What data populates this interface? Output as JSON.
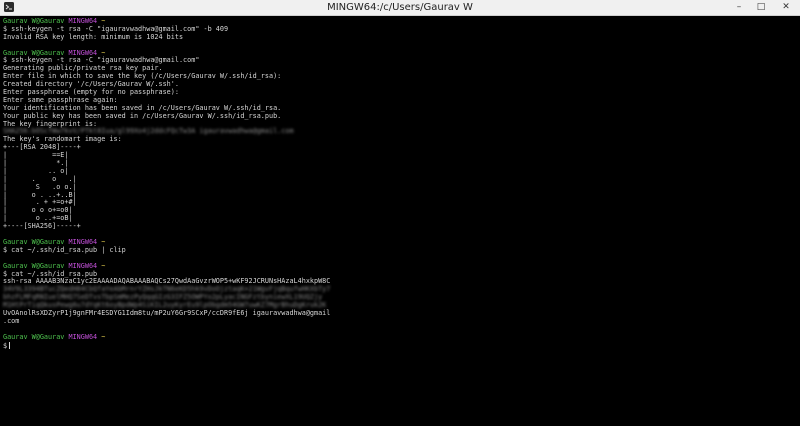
{
  "window": {
    "title": "MINGW64:/c/Users/Gaurav W",
    "minimize_glyph": "–",
    "maximize_glyph": "□",
    "close_glyph": "✕"
  },
  "colors": {
    "user": "#4ec24e",
    "host": "#c04fd6",
    "path": "#d8c24a",
    "text": "#d6d6d6",
    "background": "#000000"
  },
  "prompt": {
    "user": "Gaurav W@Gaurav",
    "host": "MINGW64",
    "path": "~",
    "symbol": "$"
  },
  "session": [
    {
      "type": "prompt"
    },
    {
      "type": "cmd",
      "text": "$ ssh-keygen -t rsa -C \"igauravwadhwa@gmail.com\" -b 409"
    },
    {
      "type": "out",
      "text": "Invalid RSA key length: minimum is 1024 bits"
    },
    {
      "type": "blank"
    },
    {
      "type": "prompt"
    },
    {
      "type": "cmd",
      "text": "$ ssh-keygen -t rsa -C \"igauravwadhwa@gmail.com\""
    },
    {
      "type": "out",
      "text": "Generating public/private rsa key pair."
    },
    {
      "type": "out",
      "text": "Enter file in which to save the key (/c/Users/Gaurav W/.ssh/id_rsa):"
    },
    {
      "type": "out",
      "text": "Created directory '/c/Users/Gaurav W/.ssh'."
    },
    {
      "type": "out",
      "text": "Enter passphrase (empty for no passphrase):"
    },
    {
      "type": "out",
      "text": "Enter same passphrase again:"
    },
    {
      "type": "out",
      "text": "Your identification has been saved in /c/Users/Gaurav W/.ssh/id_rsa."
    },
    {
      "type": "out",
      "text": "Your public key has been saved in /c/Users/Gaurav W/.ssh/id_rsa.pub."
    },
    {
      "type": "out",
      "text": "The key fingerprint is:"
    },
    {
      "type": "blurred",
      "text": "SHA256:bOScfWw7kvV/PTkt8Iua/gl99Xo4j2ddcFQcTw3A igauravwadhwa@gmail.com"
    },
    {
      "type": "out",
      "text": "The key's randomart image is:"
    },
    {
      "type": "out",
      "text": "+---[RSA 2048]----+"
    },
    {
      "type": "out",
      "text": "|           ==E|  "
    },
    {
      "type": "out",
      "text": "|            *.|  "
    },
    {
      "type": "out",
      "text": "|          .. o|  "
    },
    {
      "type": "out",
      "text": "|      .    o   .|"
    },
    {
      "type": "out",
      "text": "|       S   .o o.|"
    },
    {
      "type": "out",
      "text": "|      o . ..+..B|"
    },
    {
      "type": "out",
      "text": "|       . + +=o+#|"
    },
    {
      "type": "out",
      "text": "|      o o o+=o0|"
    },
    {
      "type": "out",
      "text": "|       o ..+=oB|"
    },
    {
      "type": "out",
      "text": "+----[SHA256]-----+"
    },
    {
      "type": "blank"
    },
    {
      "type": "prompt"
    },
    {
      "type": "cmd",
      "text": "$ cat ~/.ssh/id_rsa.pub | clip"
    },
    {
      "type": "blank"
    },
    {
      "type": "prompt"
    },
    {
      "type": "cmd",
      "text": "$ cat ~/.ssh/id_rsa.pub"
    },
    {
      "type": "out",
      "text": "ssh-rsa AAAAB3NzaC1yc2EAAAADAQABAAABAQCs27QwdAaGvzrWOP5+wKF92JCRUNsHAzaL4hxkpW8C"
    },
    {
      "type": "blurred",
      "text": "34V9L3394BTucZQedH84CbQfaYeAbMrnrYZHsJkTN6eKD5hk9vDoOjztaqK+21WgvFjqBqufwHKXbTy7"
    },
    {
      "type": "blurred",
      "text": "bhzFLMFqRNIuelMHQ7SeDTvsTbpSmMezPyQqqGIzG3IFZ5OWPYo2pLyacINGFztbyniewXL19UQZjy"
    },
    {
      "type": "blurred",
      "text": "M1HtPrTiqQkusPewg6u7dYqKt6oyBpdWp4SiKIL2uyKyrEu9lpObgdm54GW7uwKZ7MgrBhuDgKruk2K"
    },
    {
      "type": "out",
      "text": "UvOAnolRsXDZyrP1j9gnFMr4ESDYG1Idm8tu/mP2uY6Gr9SCxP/ccDR9fE6j igauravwadhwa@gmail"
    },
    {
      "type": "out",
      "text": ".com"
    },
    {
      "type": "blank"
    },
    {
      "type": "prompt"
    },
    {
      "type": "cursor",
      "text": "$"
    }
  ]
}
